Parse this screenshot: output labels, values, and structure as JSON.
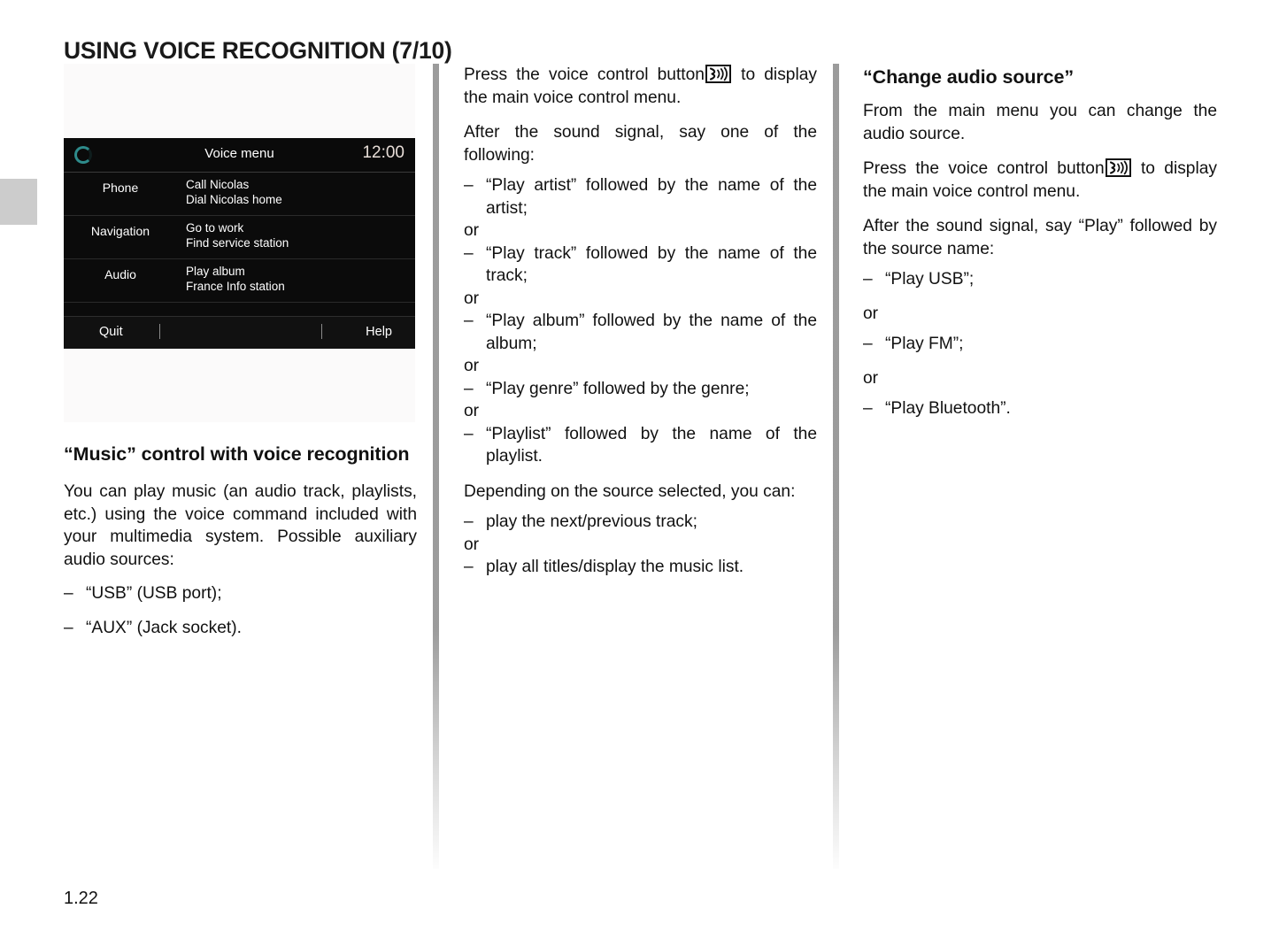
{
  "page": {
    "title": "USING VOICE RECOGNITION (7/10)",
    "number": "1.22"
  },
  "figure": {
    "screen": {
      "title": "Voice menu",
      "clock": "12:00",
      "logo_icon": "renault-logo-icon",
      "rows": [
        {
          "label": "Phone",
          "values": [
            "Call Nicolas",
            "Dial Nicolas home"
          ]
        },
        {
          "label": "Navigation",
          "values": [
            "Go to work",
            "Find service station"
          ]
        },
        {
          "label": "Audio",
          "values": [
            "Play album",
            "France Info station"
          ]
        }
      ],
      "footer": {
        "quit": "Quit",
        "help": "Help"
      }
    }
  },
  "left_column": {
    "heading": "“Music” control with voice recognition",
    "paragraph": "You can play music (an audio track, playlists, etc.) using the voice command included with your multimedia system. Possible auxiliary audio sources:",
    "bullets": [
      {
        "dash": "–",
        "text": "“USB” (USB port);"
      },
      {
        "dash": "–",
        "text": "“AUX” (Jack socket)."
      }
    ]
  },
  "middle_column": {
    "intro_before_icon": "Press the voice control button",
    "intro_icon": "voice-control-button-icon",
    "intro_after_icon": "to display the main voice control menu.",
    "sound_signal": "After the sound signal, say one of the following:",
    "or_label": "or",
    "bullets": [
      {
        "dash": "–",
        "text": "“Play artist” followed by the name of the artist;"
      },
      {
        "dash": "–",
        "text": "“Play track” followed by the name of the track;"
      },
      {
        "dash": "–",
        "text": "“Play album” followed by the name of the album;"
      },
      {
        "dash": "–",
        "text": "“Play genre” followed by the genre;"
      },
      {
        "dash": "–",
        "text": "“Playlist” followed by the name of the playlist."
      }
    ],
    "depending": "Depending on the source selected, you can:",
    "bullets2": [
      {
        "dash": "–",
        "text": "play the next/previous track;"
      },
      {
        "dash": "–",
        "text": "play all titles/display the music list."
      }
    ]
  },
  "right_column": {
    "heading": "“Change audio source”",
    "paragraph1": "From the main menu you can change the audio source.",
    "intro_before_icon": "Press the voice control button",
    "intro_icon": "voice-control-button-icon",
    "intro_after_icon": "to display the main voice control menu.",
    "paragraph2": "After the sound signal, say “Play” followed by the source name:",
    "or_label": "or",
    "bullets": [
      {
        "dash": "–",
        "text": "“Play USB”;"
      },
      {
        "dash": "–",
        "text": "“Play FM”;"
      },
      {
        "dash": "–",
        "text": "“Play Bluetooth”."
      }
    ]
  },
  "colors": {
    "screen_background": "#0b0b0b",
    "screen_text": "#ffffff",
    "logo_accent": "#2e8b8b",
    "clock_text": "#e8ded8",
    "chapter_tab": "#cccccc",
    "separator": "#969696"
  }
}
